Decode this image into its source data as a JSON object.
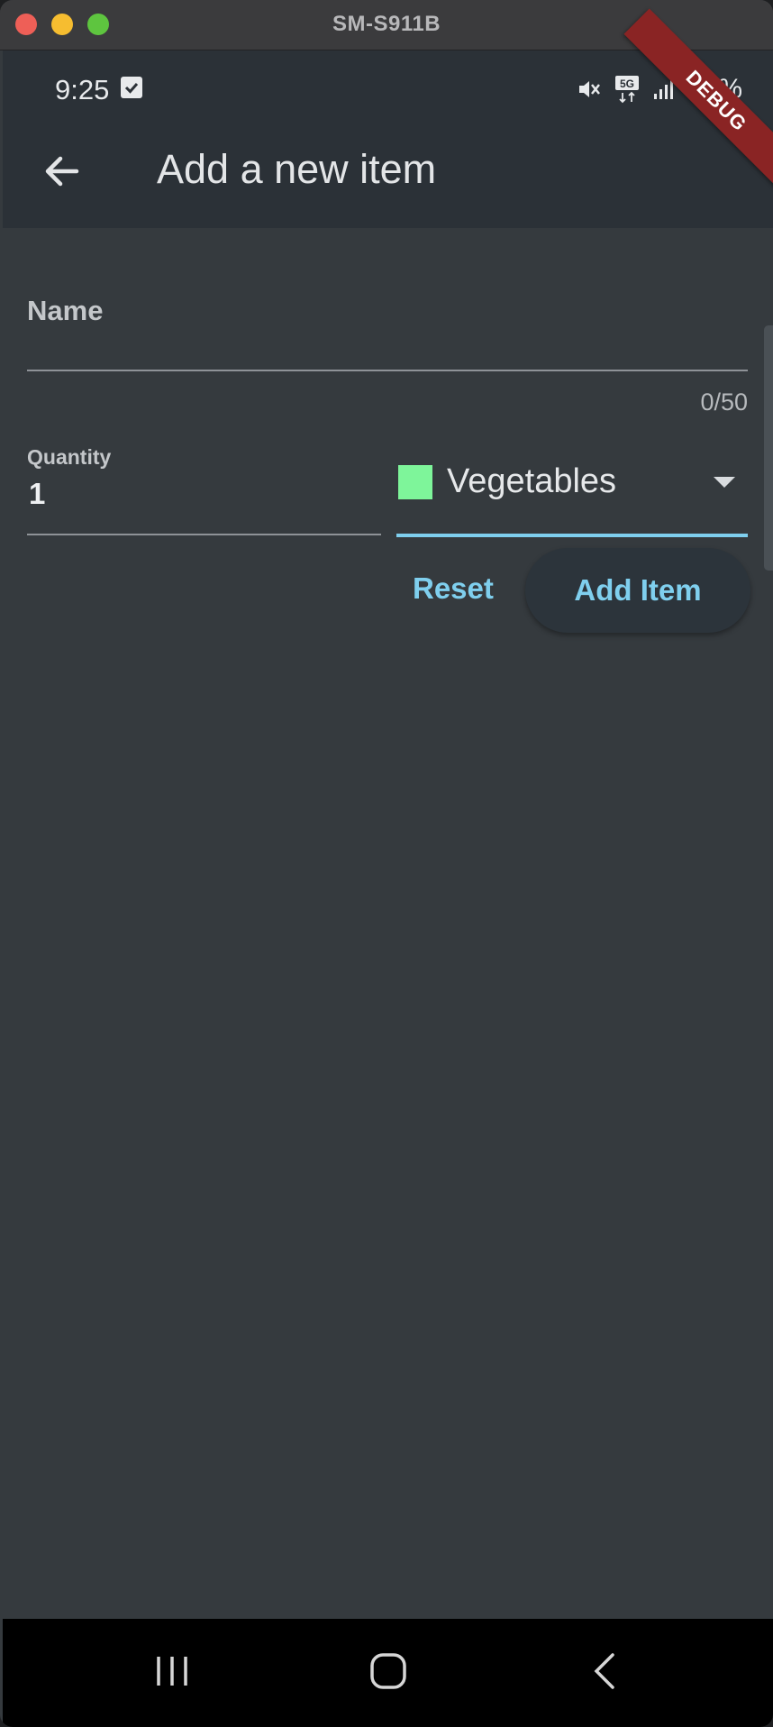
{
  "window": {
    "title": "SM-S911B"
  },
  "status_bar": {
    "time": "9:25",
    "battery": "60%"
  },
  "app_bar": {
    "title": "Add a new item"
  },
  "debug_banner": "DEBUG",
  "form": {
    "name": {
      "label": "Name",
      "value": "",
      "counter": "0/50"
    },
    "quantity": {
      "label": "Quantity",
      "value": "1"
    },
    "category": {
      "selected": "Vegetables",
      "swatch_color": "#7ef59a"
    },
    "reset_label": "Reset",
    "add_label": "Add Item"
  },
  "colors": {
    "accent": "#7fcfee",
    "background": "#353a3e",
    "app_bar": "#2b3137"
  },
  "nav_icons": [
    "recent-apps-icon",
    "home-icon",
    "back-icon"
  ]
}
